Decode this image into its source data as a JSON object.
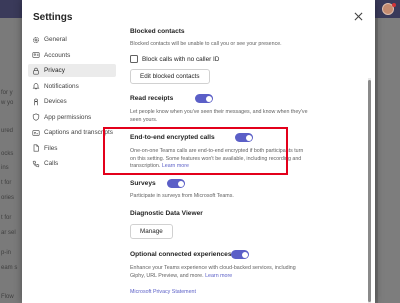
{
  "dialog": {
    "title": "Settings",
    "close_icon": "close-icon"
  },
  "nav": {
    "items": [
      {
        "label": "General",
        "icon": "gear-icon"
      },
      {
        "label": "Accounts",
        "icon": "accounts-icon"
      },
      {
        "label": "Privacy",
        "icon": "lock-icon",
        "active": true
      },
      {
        "label": "Notifications",
        "icon": "bell-icon"
      },
      {
        "label": "Devices",
        "icon": "devices-icon"
      },
      {
        "label": "App permissions",
        "icon": "app-permissions-icon"
      },
      {
        "label": "Captions and transcripts",
        "icon": "captions-icon"
      },
      {
        "label": "Files",
        "icon": "file-icon"
      },
      {
        "label": "Calls",
        "icon": "phone-icon"
      }
    ]
  },
  "blocked": {
    "title": "Blocked contacts",
    "desc": "Blocked contacts will be unable to call you or see your presence.",
    "checkbox_label": "Block calls with no caller ID",
    "button": "Edit blocked contacts"
  },
  "receipts": {
    "title": "Read receipts",
    "desc_line1": "Let people know when you've seen their messages, and know when they've",
    "desc_line2": "seen yours.",
    "toggle_on": true
  },
  "e2ee": {
    "title": "End-to-end encrypted calls",
    "desc_line1": "One-on-one Teams calls are end-to-end encrypted if both participants turn",
    "desc_line2": "on this setting. Some features won't be available, including recording and",
    "desc_line3": "transcription.",
    "learn_more": "Learn more",
    "toggle_on": true
  },
  "surveys": {
    "title": "Surveys",
    "desc": "Participate in surveys from Microsoft Teams.",
    "toggle_on": true
  },
  "diagnostic": {
    "title": "Diagnostic Data Viewer",
    "button": "Manage"
  },
  "connected": {
    "title": "Optional connected experiences",
    "desc_line1": "Enhance your Teams experience with cloud-backed services, including",
    "desc_line2": "Giphy, URL Preview, and more.",
    "learn_more": "Learn more",
    "toggle_on": true
  },
  "footer": {
    "privacy_link": "Microsoft Privacy Statement"
  },
  "background": {
    "fragments": [
      "for y",
      "w yo",
      "ured",
      "ocks",
      "ins",
      "t for",
      "ories",
      "t for",
      "ar sel",
      "p-in",
      "eam s",
      "Flow"
    ]
  },
  "colors": {
    "accent": "#5b5fc7",
    "highlight_border": "#e3001b"
  }
}
